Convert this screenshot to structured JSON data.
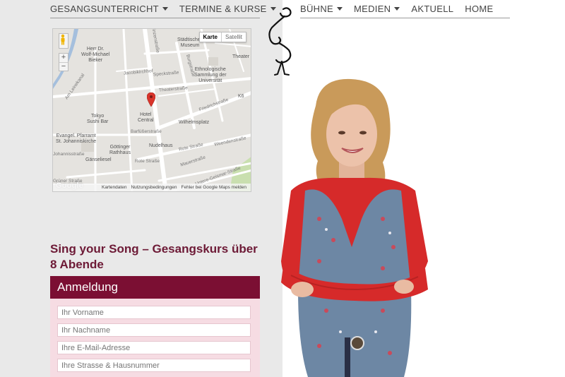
{
  "nav_left": {
    "items": [
      {
        "label": "GESANGSUNTERRICHT",
        "dropdown": true
      },
      {
        "label": "TERMINE & KURSE",
        "dropdown": true
      }
    ]
  },
  "nav_right": {
    "items": [
      {
        "label": "BÜHNE",
        "dropdown": true
      },
      {
        "label": "MEDIEN",
        "dropdown": true
      },
      {
        "label": "AKTUELL",
        "dropdown": false
      },
      {
        "label": "HOME",
        "dropdown": false
      }
    ]
  },
  "map": {
    "type_buttons": {
      "map": "Karte",
      "satellite": "Satellit"
    },
    "zoom": {
      "in": "+",
      "out": "−"
    },
    "logo": "Google",
    "footer": {
      "data": "Kartendaten",
      "terms": "Nutzungsbedingungen",
      "report": "Fehler bei Google Maps melden"
    },
    "labels": {
      "museum": "Städtisches\nMuseum",
      "bieker": "Herr Dr.\nWolf-Michael\nBieker",
      "ethno": "Ethnologische\nSammlung der\nUniversität",
      "theater": "Theater",
      "tokyo": "Tokyo\nSushi Bar",
      "hotel": "Hotel\nCentral",
      "wilhelmsplatz": "Wilhelmsplatz",
      "pfarramt": "Evangel. Pfarramt\nSt. Johanniskirche",
      "goettinger": "Göttinger\nRathhaus",
      "nudelhaus": "Nudelhaus",
      "gaenseliesel": "Gänseliesel",
      "friedrichstrasse": "Friedrichstraße",
      "theaterstrasse": "Theaterstraße",
      "barfuesser": "Barfüßerstraße",
      "rote_strasse": "Rote Straße",
      "rote_strasse_2": "Rote Straße",
      "weender": "Weendenstraße",
      "mauer": "Mauerstraße",
      "geismar": "Untere-Geismar-Straße",
      "jacobi": "Jacobikirchhof",
      "specks": "Speckstraße",
      "burg": "Burgstraße",
      "gruener": "Grüner Straße",
      "johannis": "Johannisstraße",
      "am_leinekanal": "Am Leinekanal",
      "k6": "K6",
      "prinzen": "Prinzenstraße"
    },
    "colors": {
      "land": "#e5e3df",
      "road": "#ffffff",
      "park": "#c9dfaf",
      "water": "#a5bfdd",
      "pin": "#d9342b"
    }
  },
  "course": {
    "title": "Sing your Song – Gesangskurs über 8 Abende"
  },
  "form": {
    "header": "Anmeldung",
    "fields": {
      "first_name": "Ihr Vorname",
      "last_name": "Ihr Nachname",
      "email": "Ihre E-Mail-Adresse",
      "street": "Ihre Strasse & Hausnummer"
    },
    "colors": {
      "header": "#7b0f33",
      "box": "#f6dce3"
    }
  },
  "icons": {
    "logo": "stick-figure-logo-icon",
    "pegman": "pegman-icon",
    "pin": "map-pin-icon",
    "caret": "chevron-down-icon"
  }
}
